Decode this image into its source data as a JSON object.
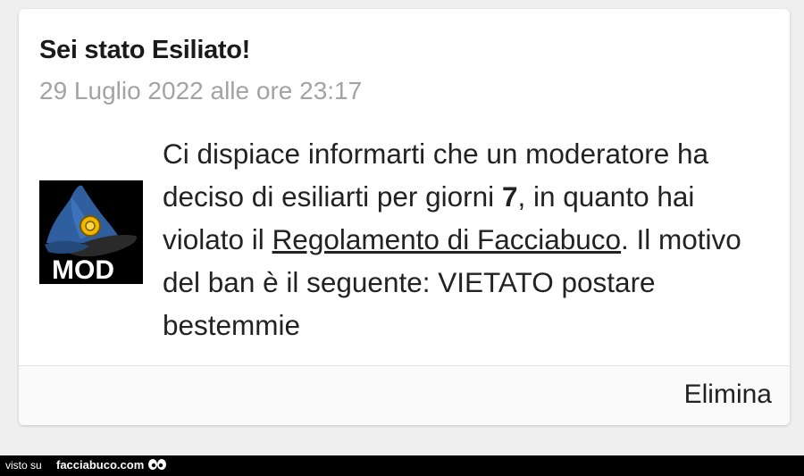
{
  "notification": {
    "title": "Sei stato Esiliato!",
    "date": "29 Luglio 2022 alle ore 23:17",
    "message": {
      "part1": "Ci dispiace informarti che un moderatore ha deciso di esiliarti per giorni ",
      "days": "7",
      "part2": ", in quanto hai violato il ",
      "link": "Regolamento di Facciabuco",
      "part3": ". Il motivo del ban è il seguente: VIETATO postare bestemmie"
    },
    "avatar_icon": "moderator-hat-icon",
    "avatar_text": "MOD",
    "delete_label": "Elimina"
  },
  "watermark": {
    "prefix": "visto su",
    "site": "facciabuco.com",
    "icon": "eyes-icon"
  },
  "colors": {
    "background": "#efefef",
    "card": "#ffffff",
    "date_text": "#a3a3a3",
    "body_text": "#222222",
    "hat_blue": "#2f5f9e",
    "badge_gold": "#f2b800"
  }
}
